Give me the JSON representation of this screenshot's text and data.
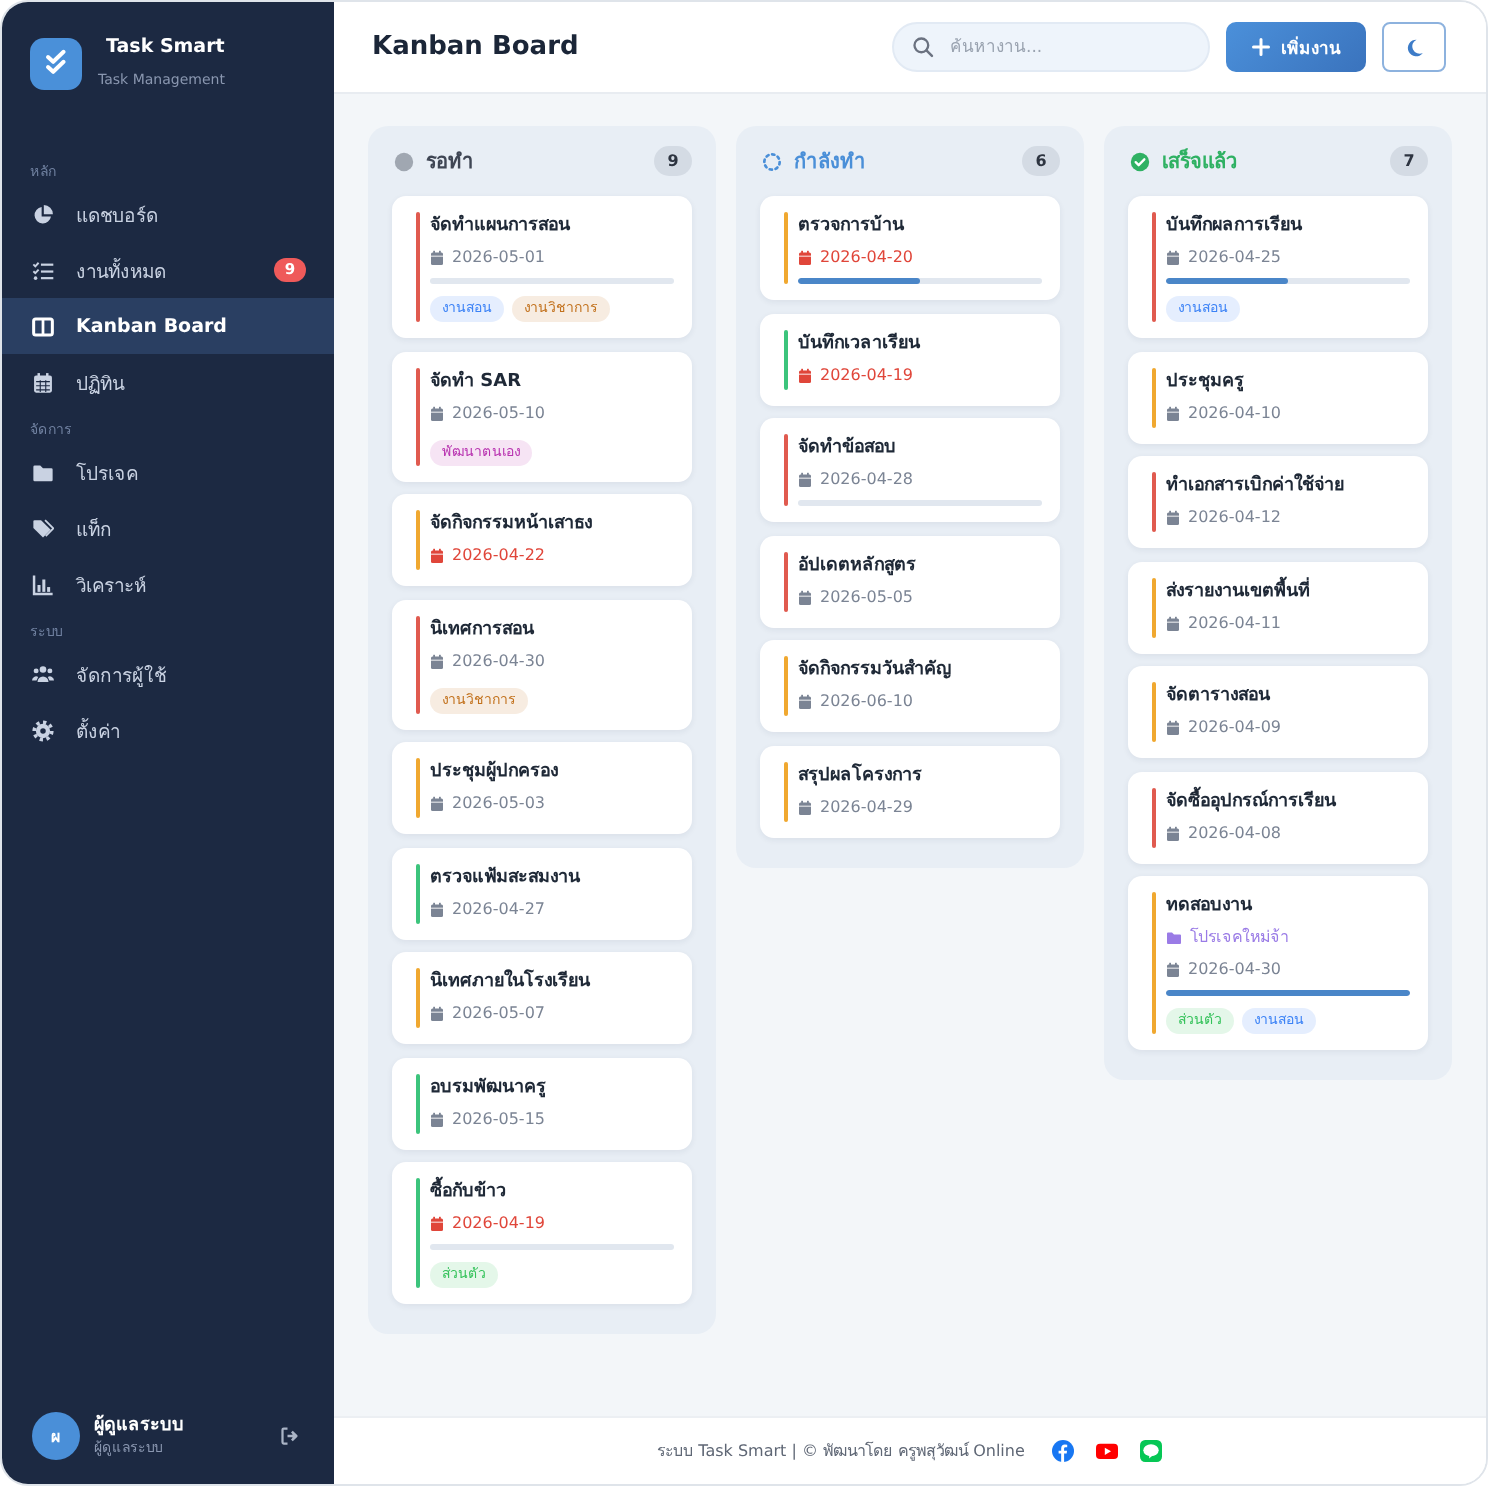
{
  "sidebar": {
    "brand": {
      "name": "Task Smart",
      "subtitle": "Task Management"
    },
    "sections": [
      {
        "label": "หลัก",
        "items": [
          {
            "label": "แดชบอร์ด",
            "selected": false
          },
          {
            "label": "งานทั้งหมด",
            "badge": "9",
            "selected": false
          },
          {
            "label": "Kanban Board",
            "selected": true
          },
          {
            "label": "ปฏิทิน",
            "selected": false
          }
        ]
      },
      {
        "label": "จัดการ",
        "items": [
          {
            "label": "โปรเจค",
            "selected": false
          },
          {
            "label": "แท็ก",
            "selected": false
          },
          {
            "label": "วิเคราะห์",
            "selected": false
          }
        ]
      },
      {
        "label": "ระบบ",
        "items": [
          {
            "label": "จัดการผู้ใช้",
            "selected": false
          },
          {
            "label": "ตั้งค่า",
            "selected": false
          }
        ]
      }
    ],
    "user": {
      "initial": "ผ",
      "name": "ผู้ดูแลระบบ",
      "role": "ผู้ดูแลระบบ"
    }
  },
  "header": {
    "title": "Kanban Board",
    "search": {
      "placeholder": "ค้นหางาน..."
    },
    "add_button": "เพิ่มงาน"
  },
  "columns": [
    {
      "kind": "waiting",
      "title": "รอทำ",
      "count": "9",
      "color": "#a0a7b1",
      "cards": [
        {
          "title": "จัดทำแผนการสอน",
          "date": "2026-05-01",
          "overdue": false,
          "color": "#e05a4f",
          "level": 0,
          "tags": [
            {
              "label": "งานสอน",
              "color": "#3b82f6"
            },
            {
              "label": "งานวิชาการ",
              "color": "#c2711c"
            }
          ]
        },
        {
          "title": "จัดทำ SAR",
          "date": "2026-05-10",
          "overdue": false,
          "color": "#e05a4f",
          "tags": [
            {
              "label": "พัฒนาตนเอง",
              "color": "#b832b0"
            }
          ]
        },
        {
          "title": "จัดกิจกรรมหน้าเสาธง",
          "date": "2026-04-22",
          "overdue": true,
          "color": "#f0a830"
        },
        {
          "title": "นิเทศการสอน",
          "date": "2026-04-30",
          "overdue": false,
          "color": "#e05a4f",
          "tags": [
            {
              "label": "งานวิชาการ",
              "color": "#c2711c"
            }
          ]
        },
        {
          "title": "ประชุมผู้ปกครอง",
          "date": "2026-05-03",
          "overdue": false,
          "color": "#f0a830"
        },
        {
          "title": "ตรวจแฟ้มสะสมงาน",
          "date": "2026-04-27",
          "overdue": false,
          "color": "#3cc47c"
        },
        {
          "title": "นิเทศภายในโรงเรียน",
          "date": "2026-05-07",
          "overdue": false,
          "color": "#f0a830"
        },
        {
          "title": "อบรมพัฒนาครู",
          "date": "2026-05-15",
          "overdue": false,
          "color": "#3cc47c"
        },
        {
          "title": "ซื้อกับข้าว",
          "date": "2026-04-19",
          "overdue": true,
          "color": "#3cc47c",
          "level": 0,
          "tags": [
            {
              "label": "ส่วนตัว",
              "color": "#34c25a"
            }
          ]
        }
      ]
    },
    {
      "kind": "progress",
      "title": "กำลังทำ",
      "count": "6",
      "color": "#4a8fd8",
      "cards": [
        {
          "title": "ตรวจการบ้าน",
          "date": "2026-04-20",
          "overdue": true,
          "color": "#f0a830",
          "level": 0.5
        },
        {
          "title": "บันทึกเวลาเรียน",
          "date": "2026-04-19",
          "overdue": true,
          "color": "#3cc47c"
        },
        {
          "title": "จัดทำข้อสอบ",
          "date": "2026-04-28",
          "overdue": false,
          "color": "#e05a4f",
          "level": 0
        },
        {
          "title": "อัปเดตหลักสูตร",
          "date": "2026-05-05",
          "overdue": false,
          "color": "#e05a4f"
        },
        {
          "title": "จัดกิจกรรมวันสำคัญ",
          "date": "2026-06-10",
          "overdue": false,
          "color": "#f0a830"
        },
        {
          "title": "สรุปผลโครงการ",
          "date": "2026-04-29",
          "overdue": false,
          "color": "#f0a830"
        }
      ]
    },
    {
      "kind": "done",
      "title": "เสร็จแล้ว",
      "count": "7",
      "color": "#2fb163",
      "cards": [
        {
          "title": "บันทึกผลการเรียน",
          "date": "2026-04-25",
          "overdue": false,
          "color": "#e05a4f",
          "level": 0.5,
          "tags": [
            {
              "label": "งานสอน",
              "color": "#3b82f6"
            }
          ]
        },
        {
          "title": "ประชุมครู",
          "date": "2026-04-10",
          "overdue": false,
          "color": "#f0a830"
        },
        {
          "title": "ทำเอกสารเบิกค่าใช้จ่าย",
          "date": "2026-04-12",
          "overdue": false,
          "color": "#e05a4f"
        },
        {
          "title": "ส่งรายงานเขตพื้นที่",
          "date": "2026-04-11",
          "overdue": false,
          "color": "#f0a830"
        },
        {
          "title": "จัดตารางสอน",
          "date": "2026-04-09",
          "overdue": false,
          "color": "#f0a830"
        },
        {
          "title": "จัดซื้ออุปกรณ์การเรียน",
          "date": "2026-04-08",
          "overdue": false,
          "color": "#e05a4f"
        },
        {
          "title": "ทดสอบงาน",
          "project": "โปรเจคใหม่จ้า",
          "date": "2026-04-30",
          "overdue": false,
          "color": "#f0a830",
          "level": 1,
          "tags": [
            {
              "label": "ส่วนตัว",
              "color": "#34c25a"
            },
            {
              "label": "งานสอน",
              "color": "#3b82f6"
            }
          ]
        }
      ]
    }
  ],
  "footer": {
    "text": "ระบบ Task Smart | © พัฒนาโดย ครูพสุวัฒน์ Online"
  }
}
